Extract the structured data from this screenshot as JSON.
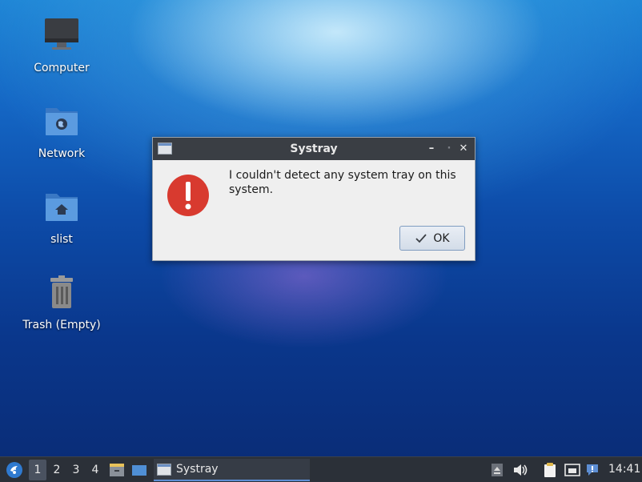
{
  "desktop": {
    "icons": [
      {
        "label": "Computer",
        "icon": "monitor-icon"
      },
      {
        "label": "Network",
        "icon": "network-folder-icon"
      },
      {
        "label": "slist",
        "icon": "home-folder-icon"
      },
      {
        "label": "Trash (Empty)",
        "icon": "trash-icon"
      }
    ]
  },
  "dialog": {
    "title": "Systray",
    "message": "I couldn't detect any system tray on this system.",
    "ok_label": "OK",
    "minimize_glyph": "–",
    "maximize_glyph": "·",
    "close_glyph": "✕",
    "icon": "error-icon"
  },
  "panel": {
    "workspaces": [
      "1",
      "2",
      "3",
      "4"
    ],
    "active_workspace": "1",
    "task_label": "Systray",
    "clock": "14:41"
  },
  "colors": {
    "panel_bg": "#2b3038",
    "titlebar_bg": "#3a3e44",
    "error_red": "#d83a2f",
    "folder_blue": "#4f8fd6"
  }
}
